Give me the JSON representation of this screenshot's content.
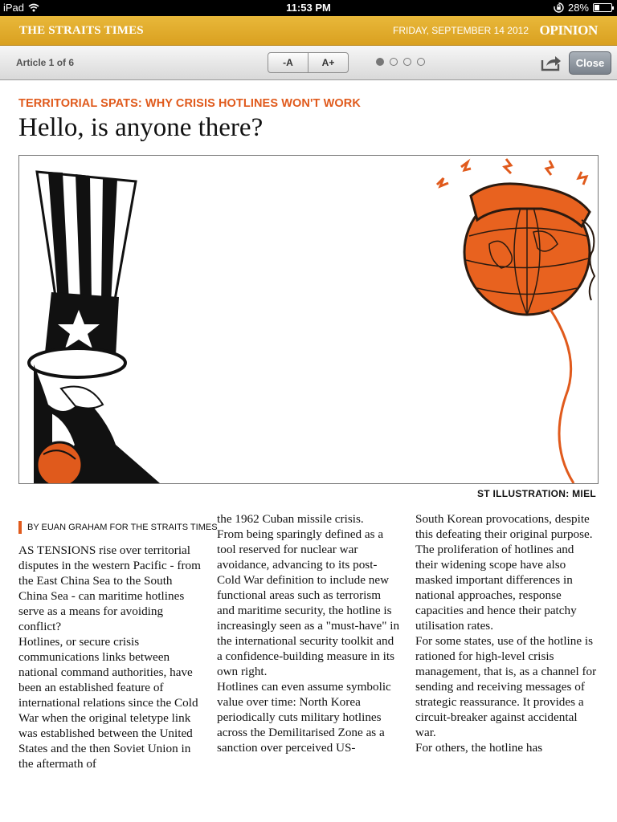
{
  "status_bar": {
    "device": "iPad",
    "time": "11:53 PM",
    "battery": "28%",
    "battery_level": 0.28
  },
  "masthead": {
    "brand": "THE STRAITS TIMES",
    "date": "FRIDAY, SEPTEMBER 14 2012",
    "section": "OPINION",
    "color": "#e0ab2d"
  },
  "toolbar": {
    "article_counter": "Article 1 of 6",
    "font_decrease": "-A",
    "font_increase": "A+",
    "pages": 4,
    "active_page": 1,
    "share_icon": "share-icon",
    "close_label": "Close"
  },
  "article": {
    "kicker": "TERRITORIAL SPATS: WHY CRISIS HOTLINES WON'T WORK",
    "headline": "Hello, is anyone there?",
    "illustration_credit": "ST ILLUSTRATION: MIEL",
    "byline": "BY EUAN GRAHAM FOR THE STRAITS TIMES",
    "accent_color": "#e05a1c",
    "col1": "AS TENSIONS rise over territorial disputes in the western Pacific - from the East China Sea to the South China Sea - can maritime hotlines serve as a means for avoiding conflict?\n Hotlines, or secure crisis communications links between national command authorities, have been an established feature of international relations since the Cold War when the original teletype link was established between the United States and the then Soviet Union in the aftermath of",
    "col2": "the 1962 Cuban missile crisis.\n From being sparingly defined as a tool reserved for nuclear war avoidance, advancing to its post-Cold War definition to include new functional areas such as terrorism and maritime security, the hotline is increasingly seen as a \"must-have\" in the international security toolkit and a confidence-building measure in its own right.\n Hotlines can even assume symbolic value over time: North Korea periodically cuts military hotlines across the Demilitarised Zone as a sanction over perceived US-",
    "col3": "South Korean provocations, despite this defeating their original purpose.\n The proliferation of hotlines and their widening scope have also masked important differences in national approaches, response capacities and hence their patchy utilisation rates.\n For some states, use of the hotline is rationed for high-level crisis management, that is, as a channel for sending and receiving messages of strategic reassurance. It provides a circuit-breaker against accidental war.\n For others, the hotline has"
  }
}
